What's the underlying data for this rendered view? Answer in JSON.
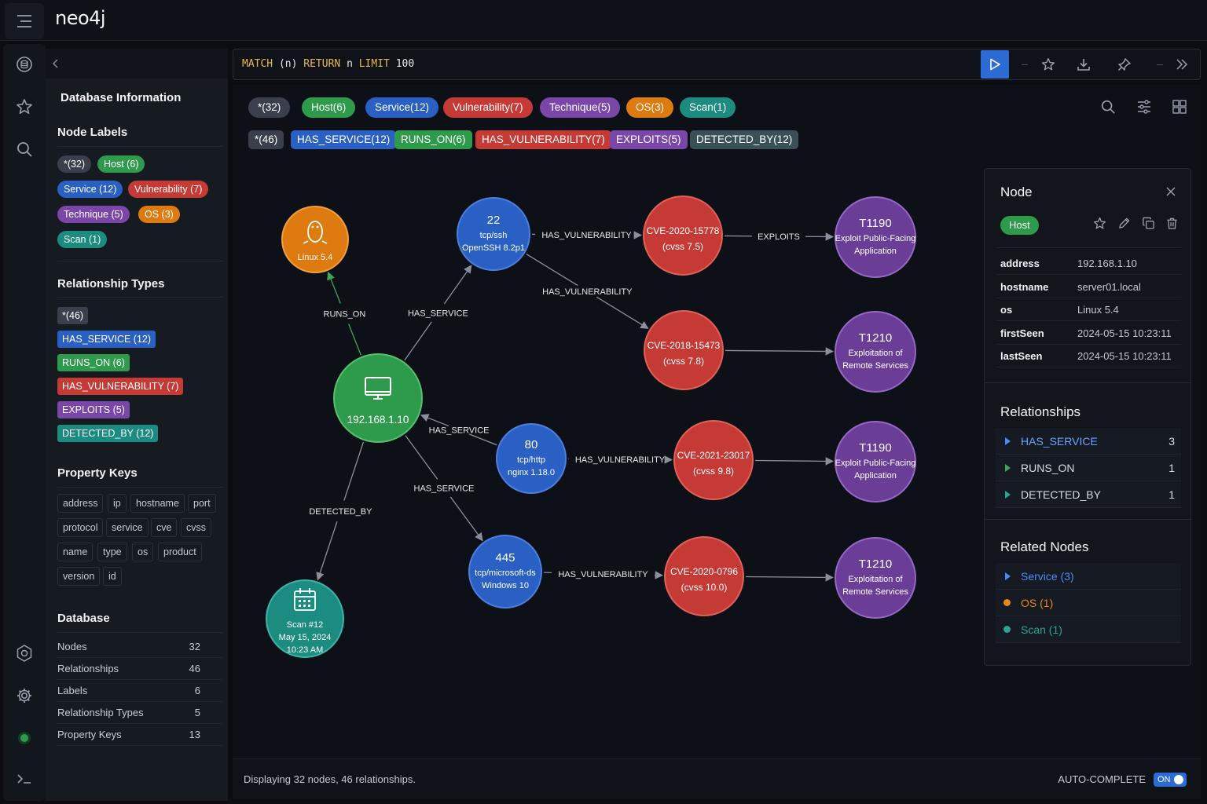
{
  "app": {
    "logo": "neo4j"
  },
  "query": {
    "text": "MATCH (n) RETURN n LIMIT 100",
    "kw1": "MATCH",
    "p1": " (n) ",
    "kw2": "RETURN",
    "p2": " n ",
    "kw3": "LIMIT",
    "p3": " 100"
  },
  "sidebar": {
    "title": "Database Information",
    "node_labels_heading": "Node Labels",
    "node_labels": [
      {
        "label": "*(32)",
        "color": "#3a404b"
      },
      {
        "label": "Host (6)",
        "color": "#2e9a4c"
      },
      {
        "label": "Service (12)",
        "color": "#2a5fc4"
      },
      {
        "label": "Vulnerability (7)",
        "color": "#c63a36"
      },
      {
        "label": "Technique (5)",
        "color": "#7a46a8"
      },
      {
        "label": "OS (3)",
        "color": "#dd7b10"
      },
      {
        "label": "Scan (1)",
        "color": "#1d8c80"
      }
    ],
    "rel_types_heading": "Relationship Types",
    "rel_types": [
      {
        "label": "*(46)",
        "color": "#3a404b"
      },
      {
        "label": "HAS_SERVICE (12)",
        "color": "#2a5fc4"
      },
      {
        "label": "RUNS_ON (6)",
        "color": "#2e9a4c"
      },
      {
        "label": "HAS_VULNERABILITY (7)",
        "color": "#c63a36"
      },
      {
        "label": "EXPLOITS (5)",
        "color": "#7a46a8"
      },
      {
        "label": "DETECTED_BY (12)",
        "color": "#1d8c80"
      }
    ],
    "prop_keys_heading": "Property Keys",
    "prop_keys": [
      "address",
      "ip",
      "hostname",
      "port",
      "protocol",
      "service",
      "cve",
      "cvss",
      "name",
      "type",
      "os",
      "product",
      "version",
      "id"
    ],
    "database_heading": "Database",
    "database": [
      {
        "label": "Nodes",
        "value": "32"
      },
      {
        "label": "Relationships",
        "value": "46"
      },
      {
        "label": "Labels",
        "value": "6"
      },
      {
        "label": "Relationship Types",
        "value": "5"
      },
      {
        "label": "Property Keys",
        "value": "13"
      }
    ]
  },
  "filters": {
    "labels": [
      {
        "label": "*(32)",
        "color": "#3a404b"
      },
      {
        "label": "Host(6)",
        "color": "#2e9a4c"
      },
      {
        "label": "Service(12)",
        "color": "#2a5fc4"
      },
      {
        "label": "Vulnerability(7)",
        "color": "#c63a36"
      },
      {
        "label": "Technique(5)",
        "color": "#7a46a8"
      },
      {
        "label": "OS(3)",
        "color": "#dd7b10"
      },
      {
        "label": "Scan(1)",
        "color": "#1d8c80"
      }
    ],
    "rels": [
      {
        "label": "*(46)",
        "color": "#3a404b"
      },
      {
        "label": "HAS_SERVICE(12)",
        "color": "#2a5fc4"
      },
      {
        "label": "RUNS_ON(6)",
        "color": "#2e9a4c"
      },
      {
        "label": "HAS_VULNERABILITY(7)",
        "color": "#c63a36"
      },
      {
        "label": "EXPLOITS(5)",
        "color": "#7a46a8"
      },
      {
        "label": "DETECTED_BY(12)",
        "color": "#3a5057"
      }
    ]
  },
  "graph": {
    "nodes": [
      {
        "id": "linux",
        "lines": [
          "Linux 5.4"
        ],
        "icon": "linux-penguin-icon"
      },
      {
        "id": "host",
        "lines": [
          "192.168.1.10"
        ],
        "icon": "monitor-icon"
      },
      {
        "id": "s22",
        "lines": [
          "22",
          "tcp/ssh",
          "OpenSSH 8.2p1"
        ]
      },
      {
        "id": "s80",
        "lines": [
          "80",
          "tcp/http",
          "nginx 1.18.0"
        ]
      },
      {
        "id": "s445",
        "lines": [
          "445",
          "tcp/microsoft-ds",
          "Windows 10"
        ]
      },
      {
        "id": "scan",
        "lines": [
          "Scan #12",
          "May 15, 2024",
          "10:23 AM"
        ],
        "icon": "calendar-icon"
      },
      {
        "id": "c1",
        "lines": [
          "CVE-2020-15778",
          "(cvss 7.5)"
        ]
      },
      {
        "id": "c2",
        "lines": [
          "CVE-2018-15473",
          "(cvss 7.8)"
        ]
      },
      {
        "id": "c3",
        "lines": [
          "CVE-2021-23017",
          "(cvss 9.8)"
        ]
      },
      {
        "id": "c4",
        "lines": [
          "CVE-2020-0796",
          "(cvss 10.0)"
        ]
      },
      {
        "id": "t1",
        "lines": [
          "T1190",
          "Exploit Public-Facing",
          "Application"
        ]
      },
      {
        "id": "t2",
        "lines": [
          "T1210",
          "Exploitation of",
          "Remote Services"
        ]
      },
      {
        "id": "t3",
        "lines": [
          "T1190",
          "Exploit Public-Facing",
          "Application"
        ]
      },
      {
        "id": "t4",
        "lines": [
          "T1210",
          "Exploitation of",
          "Remote Services"
        ]
      }
    ],
    "edges": [
      {
        "from": "host",
        "to": "linux",
        "label": "RUNS_ON",
        "color": "#3fa65a"
      },
      {
        "from": "host",
        "to": "s22",
        "label": "HAS_SERVICE",
        "color": "#8a909b"
      },
      {
        "from": "s80",
        "to": "host",
        "label": "HAS_SERVICE",
        "color": "#8a909b"
      },
      {
        "from": "host",
        "to": "s445",
        "label": "HAS_SERVICE",
        "color": "#8a909b"
      },
      {
        "from": "host",
        "to": "scan",
        "label": "DETECTED_BY",
        "color": "#8a909b"
      },
      {
        "from": "s22",
        "to": "c1",
        "label": "HAS_VULNERABILITY",
        "color": "#8a909b"
      },
      {
        "from": "s22",
        "to": "c2",
        "label": "HAS_VULNERABILITY",
        "color": "#8a909b"
      },
      {
        "from": "s80",
        "to": "c3",
        "label": "HAS_VULNERABILITY",
        "color": "#8a909b"
      },
      {
        "from": "s445",
        "to": "c4",
        "label": "HAS_VULNERABILITY",
        "color": "#8a909b"
      },
      {
        "from": "c1",
        "to": "t1",
        "label": "EXPLOITS",
        "color": "#8a909b"
      },
      {
        "from": "c2",
        "to": "t2",
        "label": "",
        "color": "#8a909b"
      },
      {
        "from": "c3",
        "to": "t3",
        "label": "",
        "color": "#8a909b"
      },
      {
        "from": "c4",
        "to": "t4",
        "label": "",
        "color": "#8a909b"
      }
    ]
  },
  "status": {
    "text": "Displaying 32 nodes, 46 relationships.",
    "autocomplete_label": "AUTO-COMPLETE",
    "autocomplete_state": "ON"
  },
  "panel": {
    "title": "Node",
    "label_badge": "Host",
    "properties": [
      {
        "key": "address",
        "value": "192.168.1.10"
      },
      {
        "key": "hostname",
        "value": "server01.local"
      },
      {
        "key": "os",
        "value": "Linux 5.4"
      },
      {
        "key": "firstSeen",
        "value": "2024-05-15 10:23:11"
      },
      {
        "key": "lastSeen",
        "value": "2024-05-15 10:23:11"
      }
    ],
    "relationships_heading": "Relationships",
    "relationships": [
      {
        "label": "HAS_SERVICE",
        "count": "3",
        "color": "#4c8bf5"
      },
      {
        "label": "RUNS_ON",
        "count": "1",
        "color": "#3fa65a"
      },
      {
        "label": "DETECTED_BY",
        "count": "1",
        "color": "#2aa594"
      }
    ],
    "related_heading": "Related Nodes",
    "related": [
      {
        "label": "Service (3)",
        "color": "#4c8bf5",
        "shape": "triangle"
      },
      {
        "label": "OS (1)",
        "color": "#e8871a",
        "shape": "dot"
      },
      {
        "label": "Scan (1)",
        "color": "#2aa594",
        "shape": "dot"
      }
    ]
  },
  "colors": {
    "accent": "#2c6ad4",
    "host": "#2e9a4c",
    "service": "#2a5fc4",
    "vuln": "#c63a36",
    "technique": "#7a46a8",
    "os": "#dd7b10",
    "scan": "#1d8c80"
  }
}
